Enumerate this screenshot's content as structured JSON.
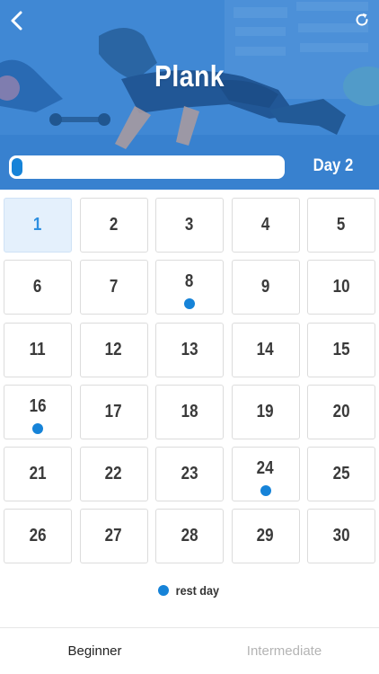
{
  "header": {
    "title": "Plank",
    "day_label": "Day 2",
    "progress_fraction": 0.04
  },
  "calendar": {
    "active_day": 1,
    "rest_days": [
      8,
      16,
      24
    ],
    "days": [
      1,
      2,
      3,
      4,
      5,
      6,
      7,
      8,
      9,
      10,
      11,
      12,
      13,
      14,
      15,
      16,
      17,
      18,
      19,
      20,
      21,
      22,
      23,
      24,
      25,
      26,
      27,
      28,
      29,
      30
    ]
  },
  "legend": {
    "label": "rest day"
  },
  "tabs": [
    {
      "label": "Beginner",
      "selected": true
    },
    {
      "label": "Intermediate",
      "selected": false
    }
  ],
  "colors": {
    "accent": "#1683d8",
    "header_bg": "#3b83cf",
    "active_cell_bg": "#e4f0fc"
  }
}
